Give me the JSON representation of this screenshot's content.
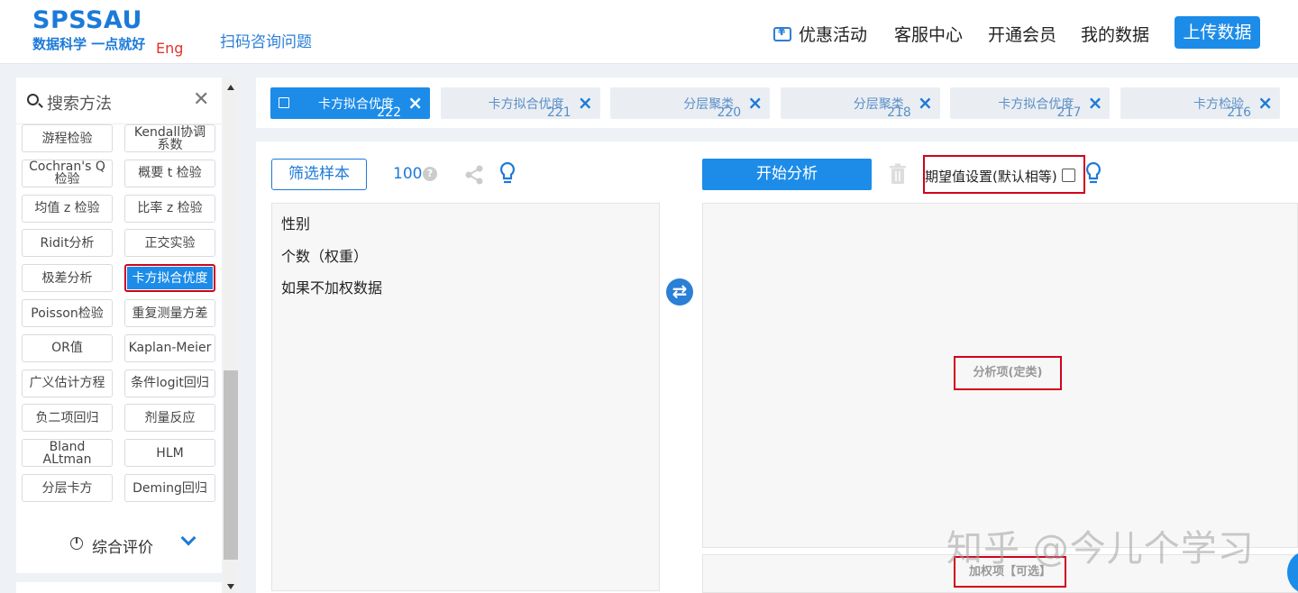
{
  "header": {
    "logo_main": "SPSSAU",
    "logo_slogan": "数据科学 一点就好",
    "lang": "Eng",
    "scan_link": "扫码咨询问题",
    "nav": {
      "promo": "优惠活动",
      "service": "客服中心",
      "member": "开通会员",
      "mydata": "我的数据",
      "upload": "上传数据"
    }
  },
  "sidebar": {
    "search_placeholder": "搜索方法",
    "methods": [
      "游程检验",
      "Kendall协调系数",
      "Cochran's Q 检验",
      "概要 t 检验",
      "均值 z 检验",
      "比率 z 检验",
      "Ridit分析",
      "正交实验",
      "极差分析",
      "卡方拟合优度",
      "Poisson检验",
      "重复测量方差",
      "OR值",
      "Kaplan-Meier",
      "广义估计方程",
      "条件logit回归",
      "负二项回归",
      "剂量反应",
      "Bland ALtman",
      "HLM",
      "分层卡方",
      "Deming回归"
    ],
    "active_method": "卡方拟合优度",
    "group_label": "综合评价"
  },
  "tabs": [
    {
      "label": "卡方拟合优度",
      "num": "222",
      "active": true
    },
    {
      "label": "卡方拟合优度",
      "num": "221"
    },
    {
      "label": "分层聚类",
      "num": "220"
    },
    {
      "label": "分层聚类",
      "num": "218"
    },
    {
      "label": "卡方拟合优度",
      "num": "217"
    },
    {
      "label": "卡方检验",
      "num": "216"
    }
  ],
  "toolbar": {
    "filter_label": "筛选样本",
    "sample_count": "100",
    "start_label": "开始分析",
    "expect_label": "期望值设置(默认相等)"
  },
  "variables": [
    "性别",
    "个数（权重）",
    "如果不加权数据"
  ],
  "zones": {
    "analysis_label": "分析项(定类)",
    "weight_label": "加权项【可选】"
  },
  "watermark": "知乎 @今儿个学习",
  "colors": {
    "brand": "#1c7ad8",
    "primary_button": "#1c8ce8",
    "highlight_red": "#d0021b"
  }
}
